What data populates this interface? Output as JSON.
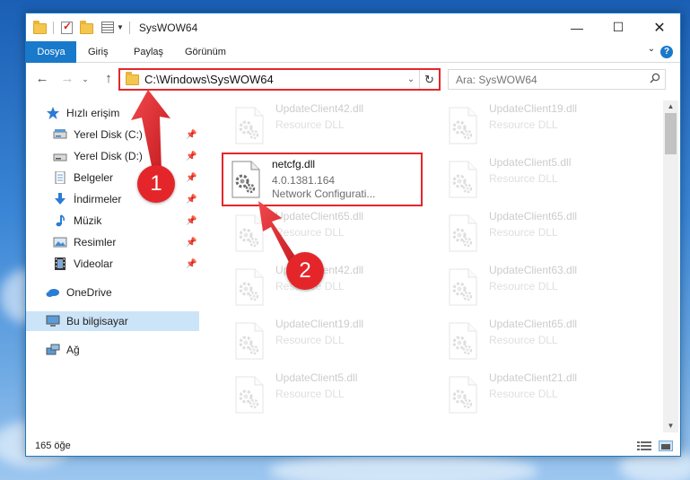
{
  "window": {
    "title": "SysWOW64"
  },
  "ribbon": {
    "tabs": [
      "Dosya",
      "Giriş",
      "Paylaş",
      "Görünüm"
    ],
    "help": "?"
  },
  "address": {
    "path": "C:\\Windows\\SysWOW64"
  },
  "search": {
    "placeholder": "Ara: SysWOW64"
  },
  "sidebar": {
    "items": [
      {
        "label": "Hızlı erişim"
      },
      {
        "label": "Yerel Disk (C:)"
      },
      {
        "label": "Yerel Disk (D:)"
      },
      {
        "label": "Belgeler"
      },
      {
        "label": "İndirmeler"
      },
      {
        "label": "Müzik"
      },
      {
        "label": "Resimler"
      },
      {
        "label": "Videolar"
      },
      {
        "label": "OneDrive"
      },
      {
        "label": "Bu bilgisayar"
      },
      {
        "label": "Ağ"
      }
    ]
  },
  "files": {
    "highlighted": {
      "name": "netcfg.dll",
      "version": "4.0.1381.164",
      "description": "Network Configurati..."
    },
    "left": [
      {
        "name": "UpdateClient42.dll",
        "type": "Resource DLL"
      },
      {
        "name": "UpdateClient65.dll",
        "type": "Resource DLL"
      },
      {
        "name": "UpdateClient42.dll",
        "type": "Resource DLL"
      },
      {
        "name": "UpdateClient19.dll",
        "type": "Resource DLL"
      },
      {
        "name": "UpdateClient5.dll",
        "type": "Resource DLL"
      }
    ],
    "right": [
      {
        "name": "UpdateClient19.dll",
        "type": "Resource DLL"
      },
      {
        "name": "UpdateClient5.dll",
        "type": "Resource DLL"
      },
      {
        "name": "UpdateClient65.dll",
        "type": "Resource DLL"
      },
      {
        "name": "UpdateClient63.dll",
        "type": "Resource DLL"
      },
      {
        "name": "UpdateClient65.dll",
        "type": "Resource DLL"
      },
      {
        "name": "UpdateClient21.dll",
        "type": "Resource DLL"
      }
    ]
  },
  "status": {
    "count": "165 öğe"
  },
  "annotations": {
    "step1": "1",
    "step2": "2",
    "color": "#e4262b"
  }
}
